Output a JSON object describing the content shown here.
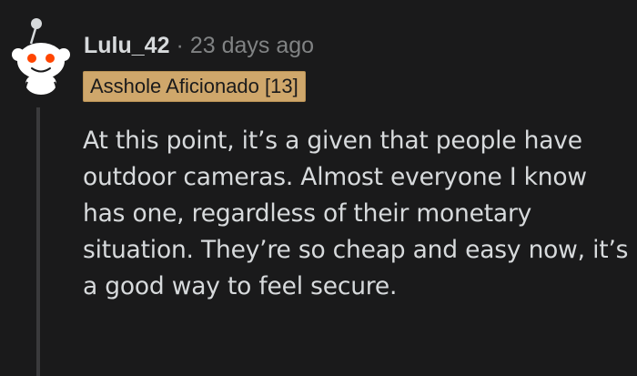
{
  "comment": {
    "author": "Lulu_42",
    "separator": "·",
    "timestamp": "23 days ago",
    "flair": "Asshole Aficionado [13]",
    "body": "At this point, it’s a given that people have outdoor cameras. Almost everyone I know has one, regardless of their monetary situation. They’re so cheap and easy now, it’s a good way to feel secure."
  },
  "colors": {
    "background": "#1a1a1b",
    "text": "#d7dadc",
    "muted": "#818384",
    "flair_bg": "#cfa76b",
    "thread_line": "#3a3a3c"
  },
  "icons": {
    "avatar": "reddit-snoo-avatar-icon"
  }
}
